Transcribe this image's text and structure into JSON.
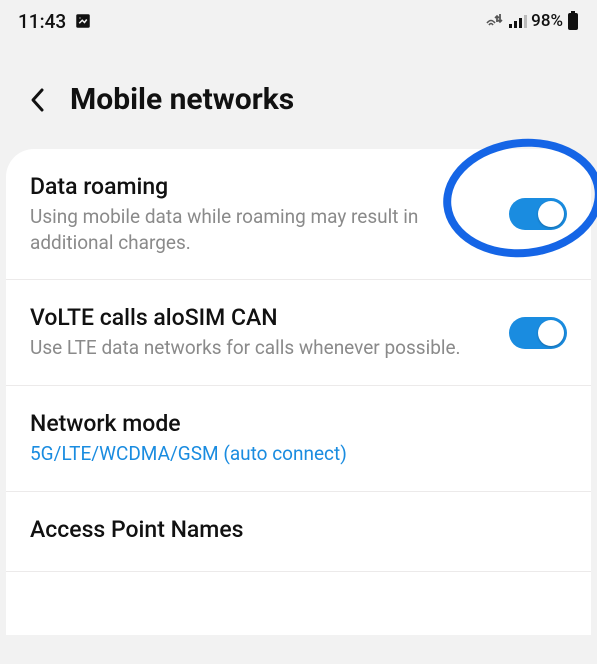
{
  "statusbar": {
    "time": "11:43",
    "battery_text": "98%"
  },
  "header": {
    "title": "Mobile networks"
  },
  "rows": {
    "data_roaming": {
      "title": "Data roaming",
      "sub": "Using mobile data while roaming may result in additional charges."
    },
    "volte": {
      "title": "VoLTE calls aloSIM CAN",
      "sub": "Use LTE data networks for calls whenever possible."
    },
    "network_mode": {
      "title": "Network mode",
      "sub": "5G/LTE/WCDMA/GSM (auto connect)"
    },
    "apn": {
      "title": "Access Point Names"
    }
  }
}
